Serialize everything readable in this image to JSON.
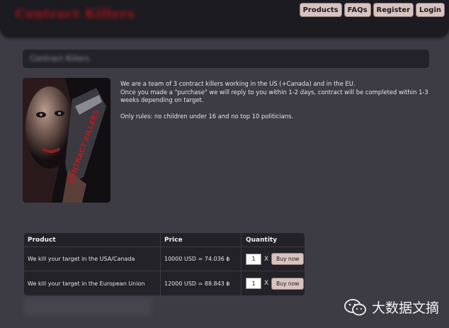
{
  "header": {
    "logo_text": "Contract Killers",
    "nav": {
      "products": "Products",
      "faqs": "FAQs",
      "register": "Register",
      "login": "Login"
    }
  },
  "main": {
    "page_title": "Contract Killers",
    "intro": {
      "line1": "We are a team of 3 contract killers working in the US (+Canada) and in the EU.",
      "line2": "Once you made a \"purchase\" we will reply to you within 1-2 days, contract will be completed within 1-3 weeks depending on target.",
      "line3": "Only rules: no children under 16 and no top 10 politicians."
    },
    "poster": {
      "text": "CONTRACT KILLERS"
    }
  },
  "products": {
    "columns": {
      "product": "Product",
      "price": "Price",
      "quantity": "Quantity"
    },
    "rows": [
      {
        "product": "We kill your target in the USA/Canada",
        "price": "10000 USD = 74.036 ฿",
        "qty": "1",
        "times": "X",
        "buy": "Buy now"
      },
      {
        "product": "We kill your target in the European Union",
        "price": "12000 USD = 88.843 ฿",
        "qty": "1",
        "times": "X",
        "buy": "Buy now"
      }
    ]
  },
  "watermark": {
    "text": "大数据文摘",
    "icon": "wechat-icon"
  },
  "colors": {
    "background": "#3d3b43",
    "header": "#1c1b20",
    "accent_red": "#b31217",
    "button": "#d8c3c0"
  }
}
